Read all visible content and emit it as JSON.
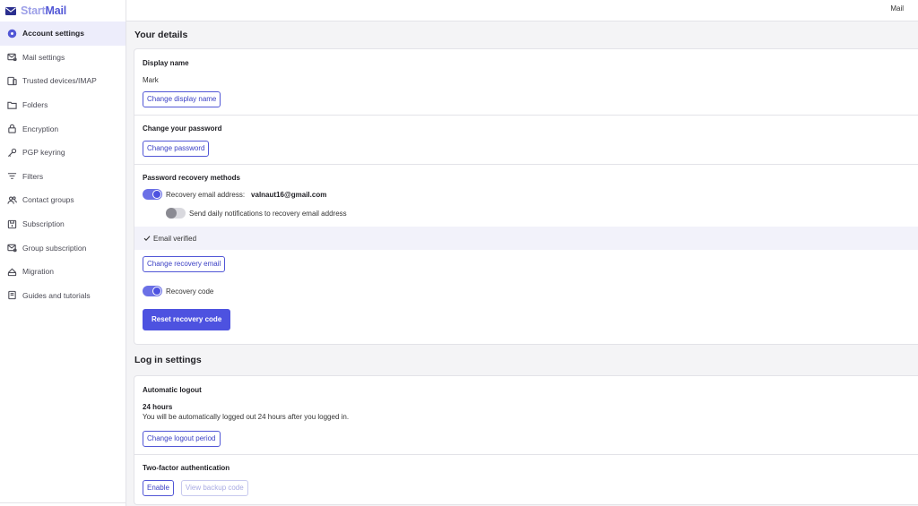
{
  "brand": {
    "start": "Start",
    "mail": "Mail"
  },
  "topbar": {
    "mail_link": "Mail"
  },
  "sidebar": {
    "items": [
      {
        "label": "Account settings",
        "icon": "gear-icon",
        "active": true
      },
      {
        "label": "Mail settings",
        "icon": "mail-settings-icon"
      },
      {
        "label": "Trusted devices/IMAP",
        "icon": "devices-icon"
      },
      {
        "label": "Folders",
        "icon": "folder-icon"
      },
      {
        "label": "Encryption",
        "icon": "lock-icon"
      },
      {
        "label": "PGP keyring",
        "icon": "key-icon"
      },
      {
        "label": "Filters",
        "icon": "filter-icon"
      },
      {
        "label": "Contact groups",
        "icon": "contact-groups-icon"
      },
      {
        "label": "Subscription",
        "icon": "subscription-icon"
      },
      {
        "label": "Group subscription",
        "icon": "group-subscription-icon"
      },
      {
        "label": "Migration",
        "icon": "migration-icon"
      },
      {
        "label": "Guides and tutorials",
        "icon": "book-icon"
      }
    ]
  },
  "your_details": {
    "title": "Your details",
    "display_name": {
      "title": "Display name",
      "value": "Mark",
      "button": "Change display name"
    },
    "password": {
      "title": "Change your password",
      "button": "Change password"
    },
    "recovery": {
      "title": "Password recovery methods",
      "email_label": "Recovery email address:",
      "email_value": "valnaut16@gmail.com",
      "email_toggle_on": true,
      "daily_label": "Send daily notifications to recovery email address",
      "daily_toggle_on": false,
      "verified_text": "Email verified",
      "change_email_button": "Change recovery email",
      "code_label": "Recovery code",
      "code_toggle_on": true,
      "reset_button": "Reset recovery code"
    }
  },
  "login_settings": {
    "title": "Log in settings",
    "logout": {
      "title": "Automatic logout",
      "period": "24 hours",
      "description": "You will be automatically logged out 24 hours after you logged in.",
      "button": "Change logout period"
    },
    "two_factor": {
      "title": "Two-factor authentication",
      "enable_button": "Enable",
      "backup_button": "View backup code"
    }
  },
  "colors": {
    "accent": "#4d52e0",
    "active_bg": "#ededfb",
    "page_bg": "#f4f4f6"
  }
}
